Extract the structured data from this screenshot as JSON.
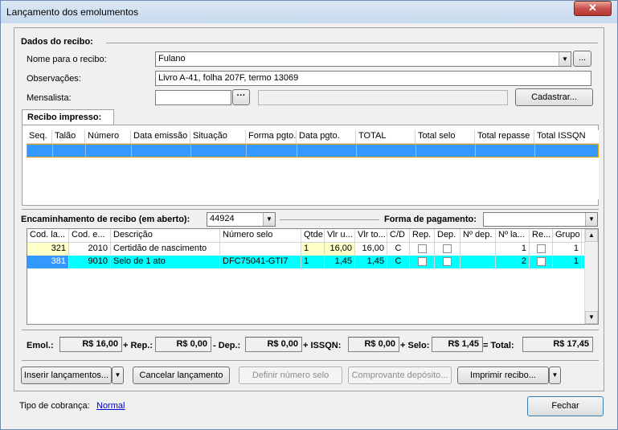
{
  "window": {
    "title": "Lançamento dos emolumentos",
    "close_label": "✕"
  },
  "recibo": {
    "section_label": "Dados do recibo:",
    "nome_label": "Nome para o recibo:",
    "nome_value": "Fulano",
    "obs_label": "Observações:",
    "obs_value": "Livro A-41, folha 207F, termo 13069",
    "mensalista_label": "Mensalista:",
    "mensalista_value": "",
    "mensalista_desc": "",
    "ellipsis_small": "...",
    "ellipsis_dots": "···",
    "cadastrar_label": "Cadastrar..."
  },
  "recibo_impresso": {
    "tab_label": "Recibo impresso:",
    "columns": [
      "Seq.",
      "Talão",
      "Número",
      "Data emissão",
      "Situação",
      "Forma pgto.",
      "Data pgto.",
      "TOTAL",
      "Total selo",
      "Total repasse",
      "Total ISSQN"
    ]
  },
  "encaminhamento": {
    "label": "Encaminhamento de recibo (em aberto):",
    "value": "44924",
    "forma_label": "Forma de pagamento:",
    "forma_value": ""
  },
  "lancamentos": {
    "columns": [
      "Cod. la...",
      "Cod. e...",
      "Descrição",
      "Número selo",
      "Qtde",
      "Vlr u...",
      "Vlr to...",
      "C/D",
      "Rep.",
      "Dep.",
      "Nº dep.",
      "Nº la...",
      "Re...",
      "Grupo"
    ],
    "rows": [
      {
        "cod_la": "321",
        "cod_e": "2010",
        "descricao": "Certidão de nascimento",
        "selo": "",
        "qtde": "1",
        "vlr_u": "16,00",
        "vlr_to": "16,00",
        "cd": "C",
        "n_dep": "",
        "n_la": "1",
        "grupo": "1"
      },
      {
        "cod_la": "381",
        "cod_e": "9010",
        "descricao": "Selo de 1 ato",
        "selo": "DFC75041-GTI7",
        "qtde": "1",
        "vlr_u": "1,45",
        "vlr_to": "1,45",
        "cd": "C",
        "n_dep": "",
        "n_la": "2",
        "grupo": "1"
      }
    ]
  },
  "totals": {
    "emol_label": "Emol.:",
    "emol": "R$ 16,00",
    "rep_label": "+ Rep.:",
    "rep": "R$ 0,00",
    "dep_label": "- Dep.:",
    "dep": "R$ 0,00",
    "issqn_label": "+ ISSQN:",
    "issqn": "R$ 0,00",
    "selo_label": "+ Selo:",
    "selo": "R$ 1,45",
    "total_label": "= Total:",
    "total": "R$ 17,45"
  },
  "actions": {
    "inserir": "Inserir lançamentos...",
    "cancelar": "Cancelar lançamento",
    "definir": "Definir número selo",
    "comprovante": "Comprovante depósito...",
    "imprimir": "Imprimir recibo...",
    "fechar": "Fechar"
  },
  "footer": {
    "tipo_label": "Tipo de cobrança:",
    "tipo_value": "Normal"
  }
}
